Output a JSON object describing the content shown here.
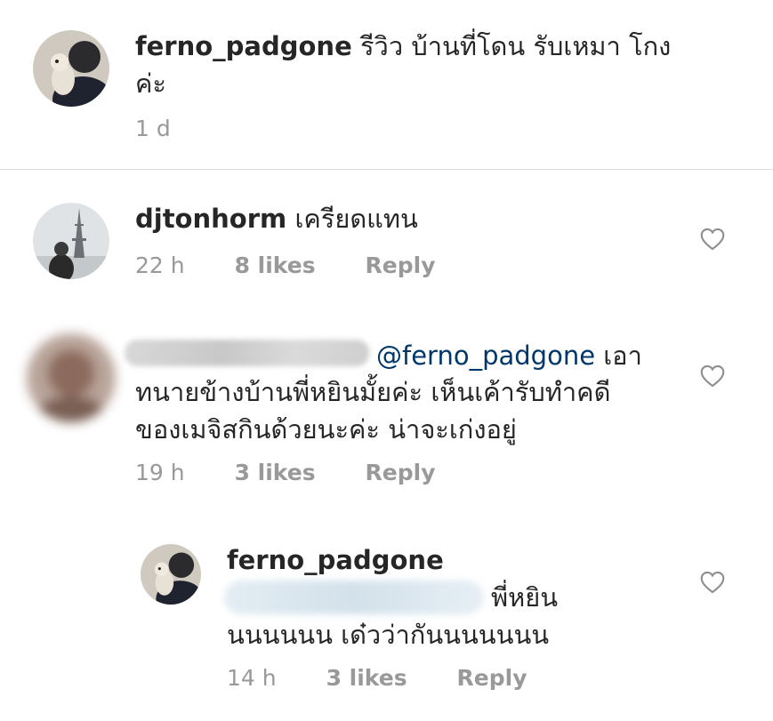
{
  "caption": {
    "username": "ferno_padgone",
    "line1": "รีวิว บ้านที่โดน รับเหมา โกง",
    "line2": "ค่ะ",
    "time": "1 d"
  },
  "comments": [
    {
      "username": "djtonhorm",
      "text": "เครียดแทน",
      "time": "22 h",
      "likes": "8 likes",
      "reply": "Reply"
    },
    {
      "mention": "@ferno_padgone",
      "line1_tail": "เอา",
      "line2": "ทนายข้างบ้านพี่หยินมั้ยค่ะ เห็นเค้ารับทำคดี",
      "line3": "ของเมจิสกินด้วยนะค่ะ น่าจะเก่งอยู่",
      "time": "19 h",
      "likes": "3 likes",
      "reply": "Reply"
    },
    {
      "username": "ferno_padgone",
      "line1_tail": "พี่หยิน",
      "line2": "นนนนนน เด๋วว่ากันนนนนนน",
      "time": "14 h",
      "likes": "3 likes",
      "reply": "Reply"
    }
  ],
  "icons": {
    "like": "heart-outline-icon"
  },
  "colors": {
    "text": "#262626",
    "meta": "#999999",
    "mention": "#00376b",
    "divider": "#dbdbdb"
  }
}
